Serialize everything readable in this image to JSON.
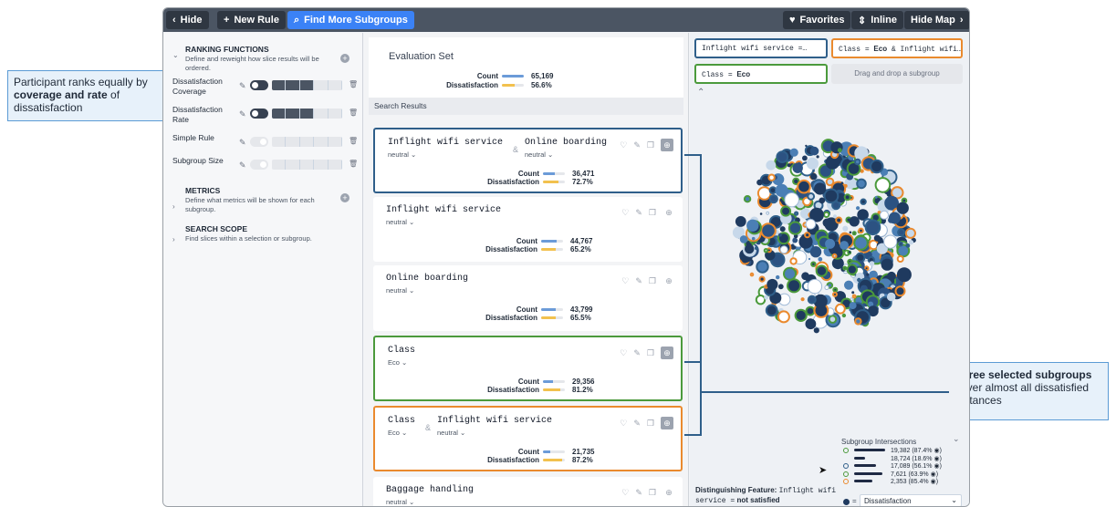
{
  "toolbar": {
    "hide_label": "Hide",
    "new_rule_label": "New Rule",
    "find_more_label": "Find More Subgroups",
    "favorites_label": "Favorites",
    "inline_label": "Inline",
    "hide_map_label": "Hide Map"
  },
  "left_panel": {
    "ranking": {
      "title": "RANKING FUNCTIONS",
      "desc": "Define and reweight how slice results will be ordered.",
      "rows": [
        {
          "label": "Dissatisfaction Coverage",
          "enabled": true,
          "weight_segments": 3
        },
        {
          "label": "Dissatisfaction Rate",
          "enabled": true,
          "weight_segments": 3
        },
        {
          "label": "Simple Rule",
          "enabled": false,
          "weight_segments": 0
        },
        {
          "label": "Subgroup Size",
          "enabled": false,
          "weight_segments": 0
        }
      ]
    },
    "metrics": {
      "title": "METRICS",
      "desc": "Define what metrics will be shown for each subgroup."
    },
    "scope": {
      "title": "SEARCH SCOPE",
      "desc": "Find slices within a selection or subgroup."
    }
  },
  "evaluation": {
    "title": "Evaluation Set",
    "count_label": "Count",
    "count_value": "65,169",
    "count_fraction": 1.0,
    "dis_label": "Dissatisfaction",
    "dis_value": "56.6%",
    "dis_fraction": 0.566
  },
  "search_results_label": "Search Results",
  "results": [
    {
      "f1": "Inflight wifi service",
      "v1": "neutral",
      "f2": "Online boarding",
      "v2": "neutral",
      "count": "36,471",
      "count_frac": 0.56,
      "dis": "72.7%",
      "dis_frac": 0.727,
      "border": "#2f5f8a",
      "globe": true
    },
    {
      "f1": "Inflight wifi service",
      "v1": "neutral",
      "count": "44,767",
      "count_frac": 0.69,
      "dis": "65.2%",
      "dis_frac": 0.652,
      "globe": false
    },
    {
      "f1": "Online boarding",
      "v1": "neutral",
      "count": "43,799",
      "count_frac": 0.67,
      "dis": "65.5%",
      "dis_frac": 0.655,
      "globe": false
    },
    {
      "f1": "Class",
      "v1": "Eco",
      "count": "29,356",
      "count_frac": 0.45,
      "dis": "81.2%",
      "dis_frac": 0.812,
      "border": "#4b9a3c",
      "globe": true
    },
    {
      "f1": "Class",
      "v1": "Eco",
      "f2": "Inflight wifi service",
      "v2": "neutral",
      "count": "21,735",
      "count_frac": 0.33,
      "dis": "87.2%",
      "dis_frac": 0.872,
      "border": "#ea8a2e",
      "globe": true
    },
    {
      "f1": "Baggage handling",
      "v1": "neutral",
      "globe": false
    }
  ],
  "metric_labels": {
    "count": "Count",
    "dis": "Dissatisfaction"
  },
  "subgroup_chips": {
    "chip1": "Inflight wifi service =…",
    "chip2_key": "Class",
    "chip2_val": "Eco",
    "chip2_rest": "& Inflight wifi…",
    "chip3_key": "Class",
    "chip3_val": "Eco",
    "drop_hint": "Drag and drop a subgroup"
  },
  "intersections": {
    "title": "Subgroup Intersections",
    "rows": [
      {
        "text": "19,382 (87.4% ◉)",
        "frac": 1.0,
        "dot": "#4b9a3c"
      },
      {
        "text": "18,724 (18.6% ◉)",
        "frac": 0.35,
        "dot": "none"
      },
      {
        "text": "17,089 (56.1% ◉)",
        "frac": 0.7,
        "dot": "#2f5f8a"
      },
      {
        "text": "7,621 (63.9% ◉)",
        "frac": 0.9,
        "dot": "#4b9a3c"
      },
      {
        "text": "2,353 (85.4% ◉)",
        "frac": 0.6,
        "dot": "#ea8a2e"
      }
    ],
    "legend_select": "Dissatisfaction"
  },
  "distinguishing": {
    "label": "Distinguishing Feature:",
    "feature": "Inflight wifi",
    "rest": "service =",
    "value": "not satisfied"
  },
  "annotations": {
    "left_pre": "Participant ranks equally by ",
    "left_bold": "coverage and rate",
    "left_mid": " of dissatisfaction",
    "right_bold": "Three selected subgroups",
    "right_rest": " cover almost all dissatisfied instances"
  },
  "colors": {
    "blue_accent": "#3b82f6",
    "count_bar": "#6b9bd8",
    "dis_bar": "#f2c14e",
    "dark_circle": "#1f3a5f",
    "green": "#4b9a3c",
    "orange": "#ea8a2e"
  }
}
